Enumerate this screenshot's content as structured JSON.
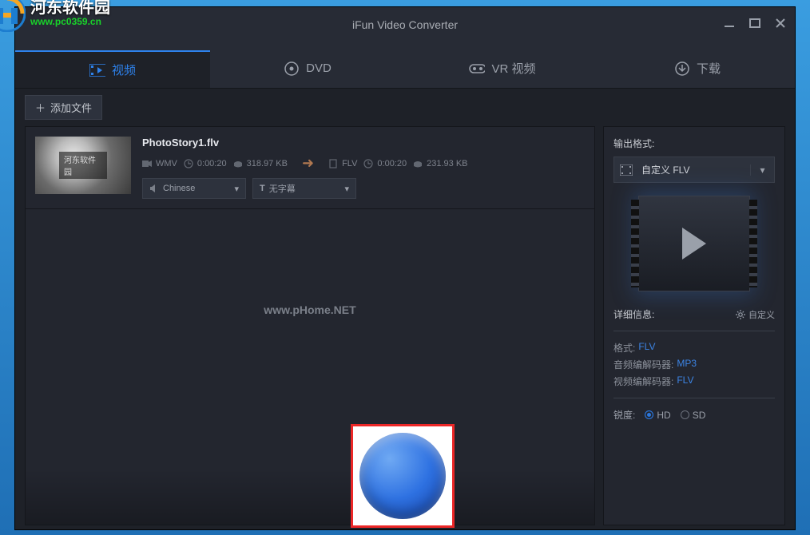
{
  "brand": {
    "cn": "河东软件园",
    "url": "www.pc0359.cn"
  },
  "title": "iFun Video Converter",
  "tabs": {
    "video": "视频",
    "dvd": "DVD",
    "vr": "VR 视频",
    "download": "下载"
  },
  "toolbar": {
    "add_file": "添加文件"
  },
  "file": {
    "name": "PhotoStory1.flv",
    "src": {
      "fmt": "WMV",
      "dur": "0:00:20",
      "size": "318.97 KB"
    },
    "dst": {
      "fmt": "FLV",
      "dur": "0:00:20",
      "size": "231.93 KB"
    },
    "lang": "Chinese",
    "subtitle": "无字幕",
    "thumb_label": "河东软件园"
  },
  "watermark": "www.pHome.NET",
  "sidebar": {
    "output_label": "输出格式:",
    "format_select": "自定义 FLV",
    "detail_label": "详细信息:",
    "customize": "自定义",
    "rows": {
      "format_k": "格式:",
      "format_v": "FLV",
      "aenc_k": "音频编解码器:",
      "aenc_v": "MP3",
      "venc_k": "视频编解码器:",
      "venc_v": "FLV"
    },
    "sharp_label": "锐度:",
    "hd": "HD",
    "sd": "SD"
  }
}
